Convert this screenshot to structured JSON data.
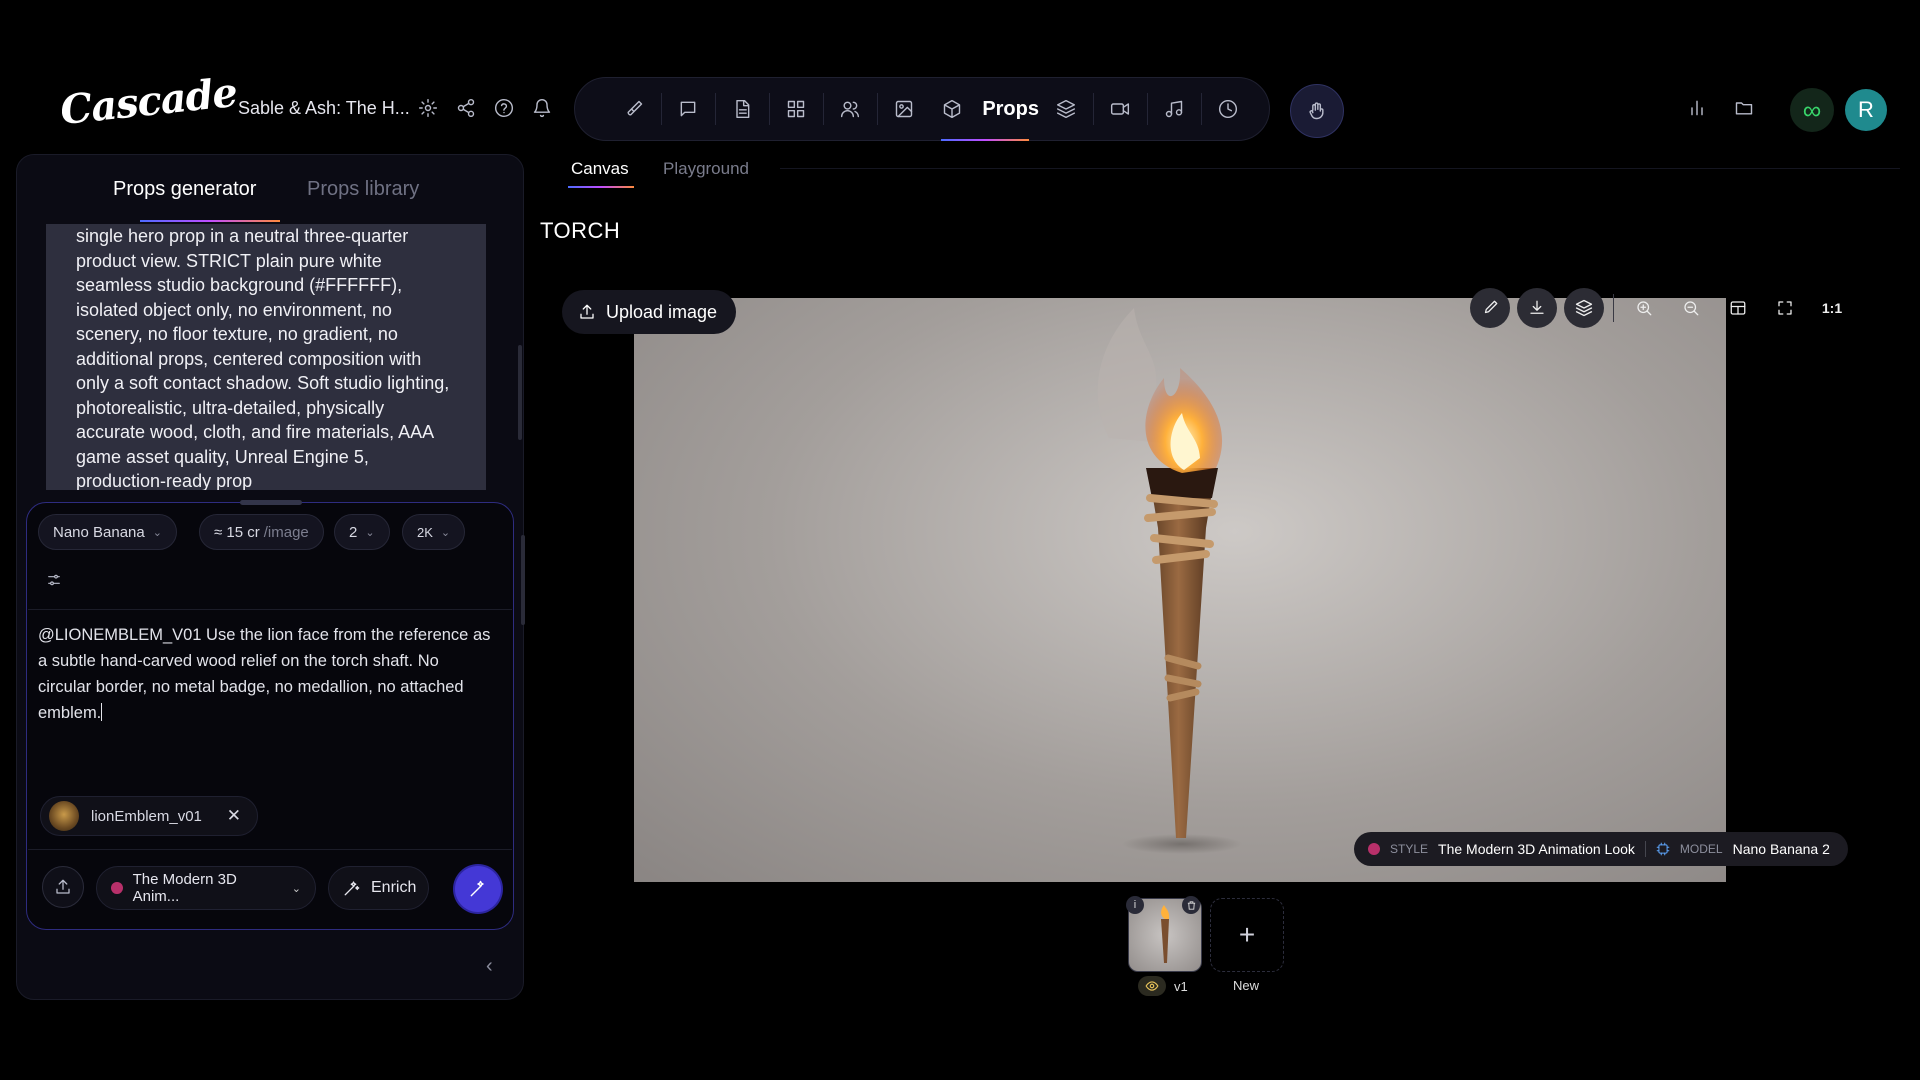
{
  "app": {
    "logo": "Cascade",
    "project_title": "Sable & Ash: The H..."
  },
  "nav": {
    "active_label": "Props"
  },
  "left_panel": {
    "tabs": {
      "generator": "Props generator",
      "library": "Props library"
    },
    "prompt_text": "single hero prop in a neutral three-quarter product view. STRICT plain pure white seamless studio background (#FFFFFF), isolated object only, no environment, no scenery, no floor texture, no gradient, no additional props, centered composition with only a soft contact shadow. Soft studio lighting, photorealistic, ultra-detailed, physically accurate wood, cloth, and fire materials, AAA game asset quality, Unreal Engine 5, production-ready prop",
    "model": "Nano Banana",
    "cost_value": "≈ 15 cr",
    "cost_unit": "/image",
    "count": "2",
    "resolution": "2K",
    "message": "@LIONEMBLEM_V01 Use the lion face from the reference as a subtle hand-carved wood relief on the torch shaft. No circular border, no metal badge, no medallion, no attached emblem.",
    "reference_chip": "lionEmblem_v01",
    "style_select": "The Modern 3D Anim...",
    "enrich_label": "Enrich"
  },
  "canvas": {
    "tabs": {
      "canvas": "Canvas",
      "playground": "Playground"
    },
    "title": "TORCH",
    "upload_label": "Upload image",
    "zoom_reset_label": "1:1",
    "meta": {
      "style_label": "STYLE",
      "style_value": "The Modern 3D Animation Look",
      "model_label": "MODEL",
      "model_value": "Nano Banana 2"
    },
    "versions": {
      "v1_label": "v1",
      "new_label": "New"
    }
  },
  "colors": {
    "accent": "#4438d6",
    "brand_gradient": [
      "#4d6bff",
      "#c04dff",
      "#ff8a3d"
    ],
    "status_green": "#38d46a",
    "avatar": "#1f8a8e"
  },
  "user": {
    "avatar_initial": "R"
  }
}
